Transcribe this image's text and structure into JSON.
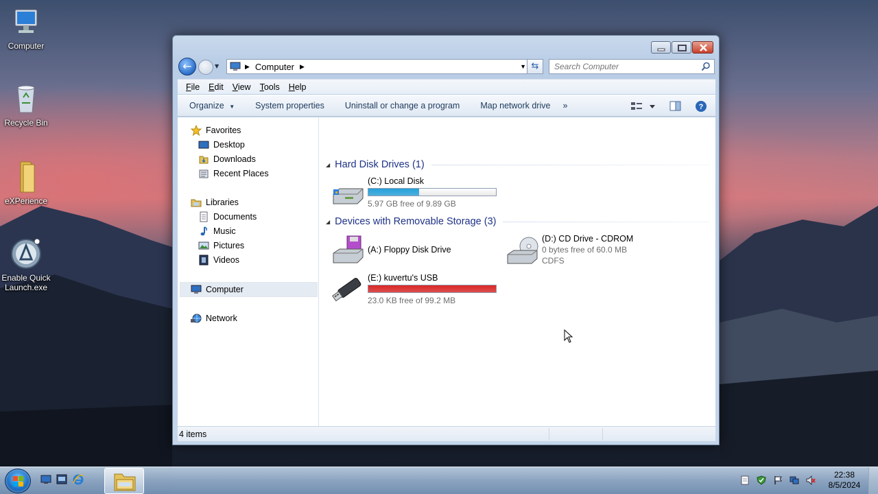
{
  "desktop": {
    "icons": [
      {
        "label": "Computer",
        "icon": "computer-icon"
      },
      {
        "label": "Recycle Bin",
        "icon": "recycle-bin-icon"
      },
      {
        "label": "eXPerience",
        "icon": "folder-icon"
      },
      {
        "label": "Enable Quick Launch.exe",
        "icon": "quick-launch-icon"
      }
    ]
  },
  "window": {
    "address": {
      "path": "Computer"
    },
    "search": {
      "placeholder": "Search Computer"
    },
    "menu": [
      "File",
      "Edit",
      "View",
      "Tools",
      "Help"
    ],
    "commands": [
      "Organize",
      "System properties",
      "Uninstall or change a program",
      "Map network drive",
      "»"
    ],
    "nav": {
      "favorites": {
        "label": "Favorites",
        "items": [
          "Desktop",
          "Downloads",
          "Recent Places"
        ]
      },
      "libraries": {
        "label": "Libraries",
        "items": [
          "Documents",
          "Music",
          "Pictures",
          "Videos"
        ]
      },
      "computer": "Computer",
      "network": "Network"
    },
    "groups": {
      "hdd": {
        "title": "Hard Disk Drives (1)",
        "drives": [
          {
            "name": "(C:) Local Disk",
            "info": "5.97 GB free of 9.89 GB",
            "used_fraction": 0.396,
            "bar_color": "#26a0da"
          }
        ]
      },
      "removable": {
        "title": "Devices with Removable Storage (3)",
        "drives": [
          {
            "name": "(A:) Floppy Disk Drive"
          },
          {
            "name": "(D:) CD Drive - CDROM",
            "info": "0 bytes free of 60.0 MB",
            "info2": "CDFS"
          },
          {
            "name": "(E:) kuvertu's USB",
            "info": "23.0 KB free of 99.2 MB",
            "used_fraction": 0.9998,
            "bar_color": "#da2626"
          }
        ]
      }
    },
    "status": {
      "items": "4 items"
    }
  },
  "taskbar": {
    "clock": {
      "time": "22:38",
      "date": "8/5/2024"
    }
  }
}
